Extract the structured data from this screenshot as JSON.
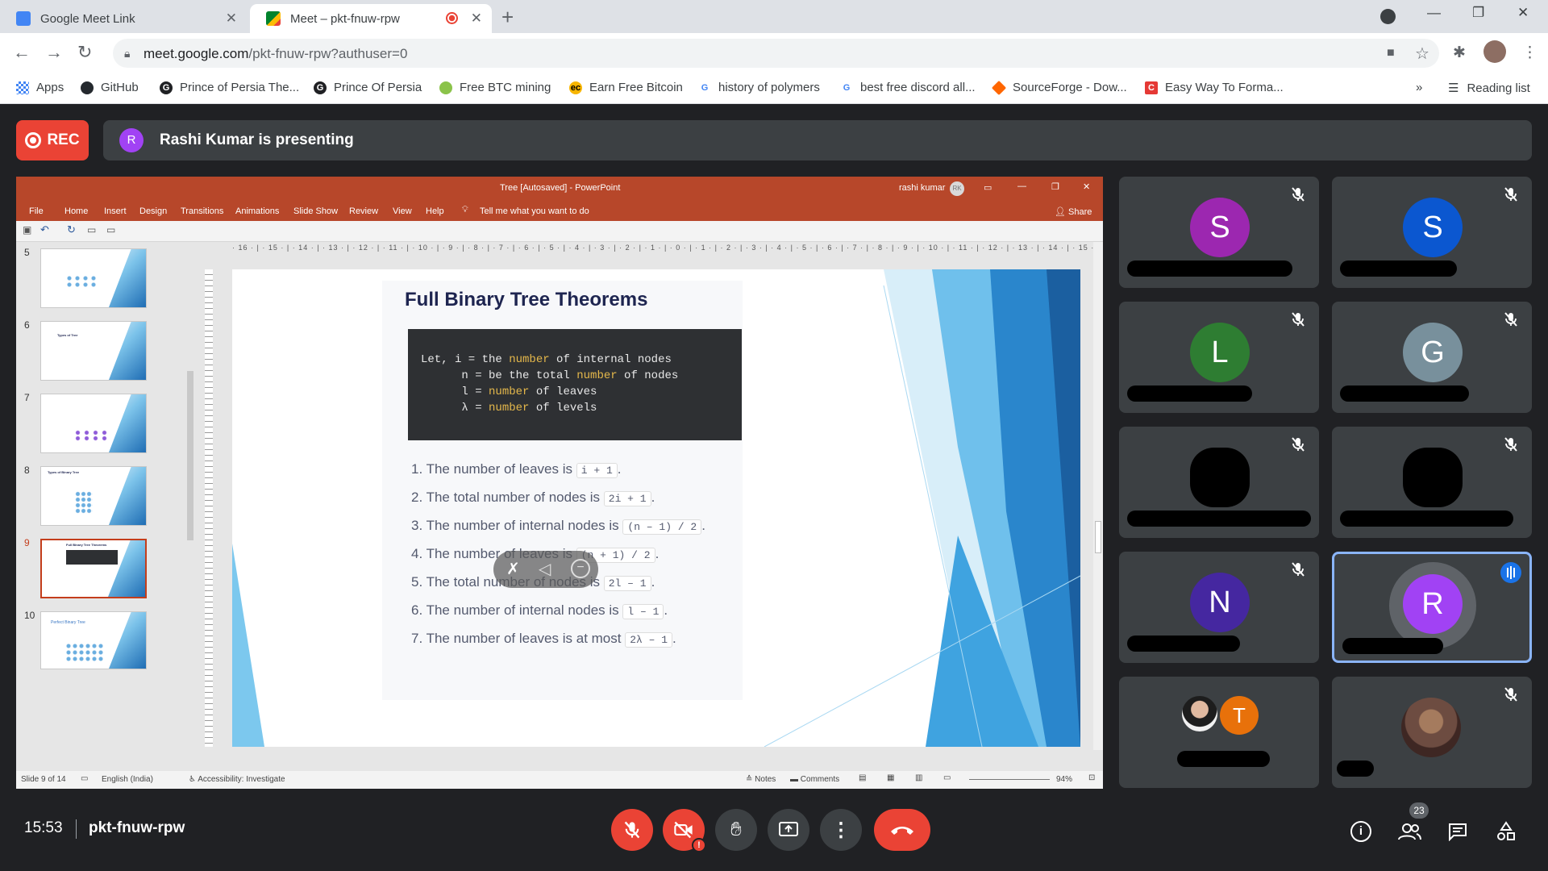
{
  "browser": {
    "tabs": [
      {
        "title": "Google Meet Link"
      },
      {
        "title": "Meet – pkt-fnuw-rpw"
      }
    ],
    "url_host": "meet.google.com",
    "url_path": "/pkt-fnuw-rpw?authuser=0",
    "bookmarks": [
      {
        "label": "Apps",
        "icon": "apps-grid-icon"
      },
      {
        "label": "GitHub",
        "icon": "github-icon"
      },
      {
        "label": "Prince of Persia The...",
        "icon": "g-circle-icon"
      },
      {
        "label": "Prince Of Persia",
        "icon": "g-circle-icon"
      },
      {
        "label": "Free BTC mining",
        "icon": "btc-mining-icon"
      },
      {
        "label": "Earn Free Bitcoin",
        "icon": "bitcoin-icon"
      },
      {
        "label": "history of polymers",
        "icon": "google-icon"
      },
      {
        "label": "best free discord all...",
        "icon": "google-icon"
      },
      {
        "label": "SourceForge - Dow...",
        "icon": "sourceforge-icon"
      },
      {
        "label": "Easy Way To Forma...",
        "icon": "c-icon"
      }
    ],
    "more_bookmarks": "»",
    "reading_list": "Reading list"
  },
  "meet": {
    "rec_label": "REC",
    "presenter_initial": "R",
    "presenting_text": "Rashi Kumar is presenting",
    "time": "15:53",
    "meeting_code": "pkt-fnuw-rpw",
    "participant_count": "23",
    "accent_red": "#ea4335"
  },
  "ppt": {
    "window_title": "Tree [Autosaved]  -  PowerPoint",
    "user": "rashi kumar",
    "user_initials": "RK",
    "menu": [
      "File",
      "Home",
      "Insert",
      "Design",
      "Transitions",
      "Animations",
      "Slide Show",
      "Review",
      "View",
      "Help"
    ],
    "tell_me": "Tell me what you want to do",
    "share": "Share",
    "ruler": "· 16 · | · 15 · | · 14 · | · 13 · | · 12 · | · 11 · | · 10 · | · 9 · | · 8 · | · 7 · | · 6 · | · 5 · | · 4 · | · 3 · | · 2 · | · 1 · | · 0 · | · 1 · | · 2 · | · 3 · | · 4 · | · 5 · | · 6 · | · 7 · | · 8 · | · 9 · | · 10 · | · 11 · | · 12 · | · 13 · | · 14 · | · 15 · | · 16 ·",
    "thumb_numbers": [
      "5",
      "6",
      "7",
      "8",
      "9",
      "10"
    ],
    "thumb_titles": [
      "",
      "Types of Tree",
      "",
      "Types of Binary Tree",
      "Full Binary Tree Theorems",
      "Perfect Binary Tree"
    ],
    "status": {
      "slide": "Slide 9 of 14",
      "language": "English (India)",
      "accessibility": "Accessibility: Investigate",
      "notes": "Notes",
      "comments": "Comments",
      "zoom": "94%"
    }
  },
  "slide": {
    "title": "Full Binary Tree Theorems",
    "code_lines": [
      {
        "pre": "Let, i = the ",
        "hl": "number",
        "post": " of internal nodes"
      },
      {
        "pre": "      n = be the total ",
        "hl": "number",
        "post": " of nodes"
      },
      {
        "pre": "      l = ",
        "hl": "number",
        "post": " of leaves"
      },
      {
        "pre": "      λ = ",
        "hl": "number",
        "post": " of levels"
      }
    ],
    "theorems": [
      {
        "text": "1. The number of leaves is ",
        "code": "i + 1",
        "end": "."
      },
      {
        "text": "2. The total number of nodes is ",
        "code": "2i + 1",
        "end": "."
      },
      {
        "text": "3. The number of internal nodes is ",
        "code": "(n – 1) / 2",
        "end": "."
      },
      {
        "text": "4. The number of leaves is ",
        "code": "(n + 1) / 2",
        "end": "."
      },
      {
        "text": "5. The total number of nodes is ",
        "code": "2l – 1",
        "end": "."
      },
      {
        "text": "6. The number of internal nodes is ",
        "code": "l – 1",
        "end": "."
      },
      {
        "text": "7. The number of leaves is at most ",
        "code": "2λ – 1",
        "end": "."
      }
    ]
  },
  "participants": [
    {
      "initial": "S",
      "color": "#9c27b0",
      "muted": true
    },
    {
      "initial": "S",
      "color": "#0b57d0",
      "muted": true
    },
    {
      "initial": "L",
      "color": "#2e7d32",
      "muted": true
    },
    {
      "initial": "G",
      "color": "#78909c",
      "muted": true
    },
    {
      "initial": "",
      "color": "#000000",
      "muted": true
    },
    {
      "initial": "",
      "color": "#000000",
      "muted": true
    },
    {
      "initial": "N",
      "color": "#4527a0",
      "muted": true
    },
    {
      "initial": "R",
      "color": "#a142f4",
      "muted": false,
      "speaking": true
    },
    {
      "initial": "T",
      "color": "#e8710a",
      "muted": false
    },
    {
      "initial": "",
      "color": "#6d4c41",
      "muted": true
    }
  ]
}
